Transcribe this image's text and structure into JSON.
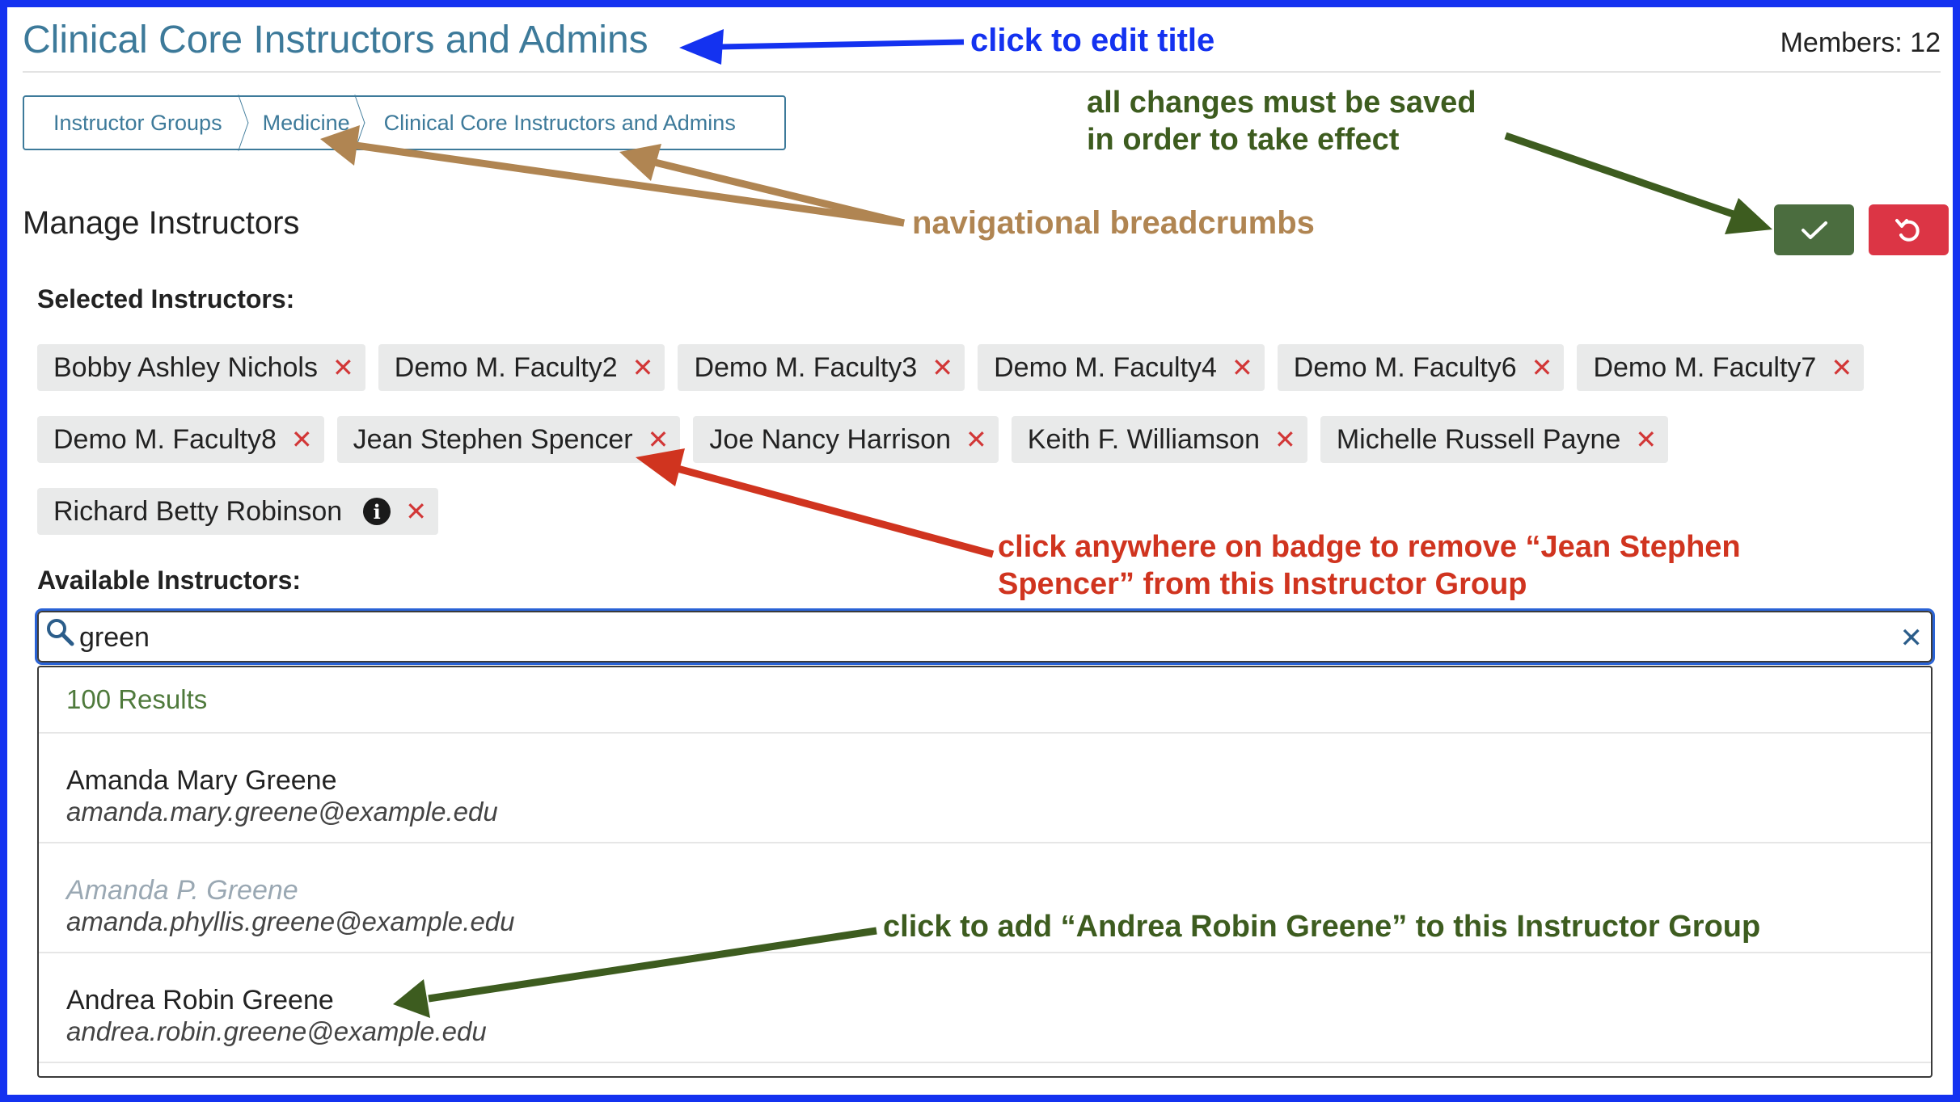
{
  "header": {
    "title": "Clinical Core Instructors and Admins",
    "members": "Members: 12"
  },
  "breadcrumbs": [
    "Instructor Groups",
    "Medicine",
    "Clinical Core Instructors and Admins"
  ],
  "section_title": "Manage Instructors",
  "selected_label": "Selected Instructors:",
  "selected_instructors": [
    "Bobby Ashley Nichols",
    "Demo M. Faculty2",
    "Demo M. Faculty3",
    "Demo M. Faculty4",
    "Demo M. Faculty6",
    "Demo M. Faculty7",
    "Demo M. Faculty8",
    "Jean Stephen Spencer",
    "Joe Nancy Harrison",
    "Keith F. Williamson",
    "Michelle Russell Payne",
    "Richard Betty Robinson"
  ],
  "available_label": "Available Instructors:",
  "search": {
    "value": "green"
  },
  "results": {
    "count": "100 Results",
    "items": [
      {
        "name": "Amanda Mary Greene",
        "email": "amanda.mary.greene@example.edu"
      },
      {
        "name": "Amanda P. Greene",
        "email": "amanda.phyllis.greene@example.edu"
      },
      {
        "name": "Andrea Robin Greene",
        "email": "andrea.robin.greene@example.edu"
      }
    ]
  },
  "annotations": {
    "edit_title": "click to edit title",
    "save_note": [
      "all changes must be saved",
      "in order to take effect"
    ],
    "breadcrumbs_note": "navigational breadcrumbs",
    "remove_note": [
      "click anywhere on badge to remove “Jean Stephen",
      "Spencer” from this Instructor Group"
    ],
    "add_note": "click to add “Andrea Robin Greene” to this Instructor Group"
  },
  "icons": {
    "save": "check-icon",
    "undo": "undo-icon",
    "remove": "close-icon",
    "info": "info-icon",
    "search": "search-icon",
    "clear": "clear-icon"
  },
  "colors": {
    "frame": "#1432f0",
    "title": "#3d7a9a",
    "save": "#4b6d3f",
    "undo": "#dc3545",
    "remove_x": "#d23737",
    "results_count": "#4f7a3c",
    "annotation_blue": "#1432f0",
    "annotation_green": "#3d5c1f",
    "annotation_brown": "#b08552",
    "annotation_red": "#d0341f"
  }
}
